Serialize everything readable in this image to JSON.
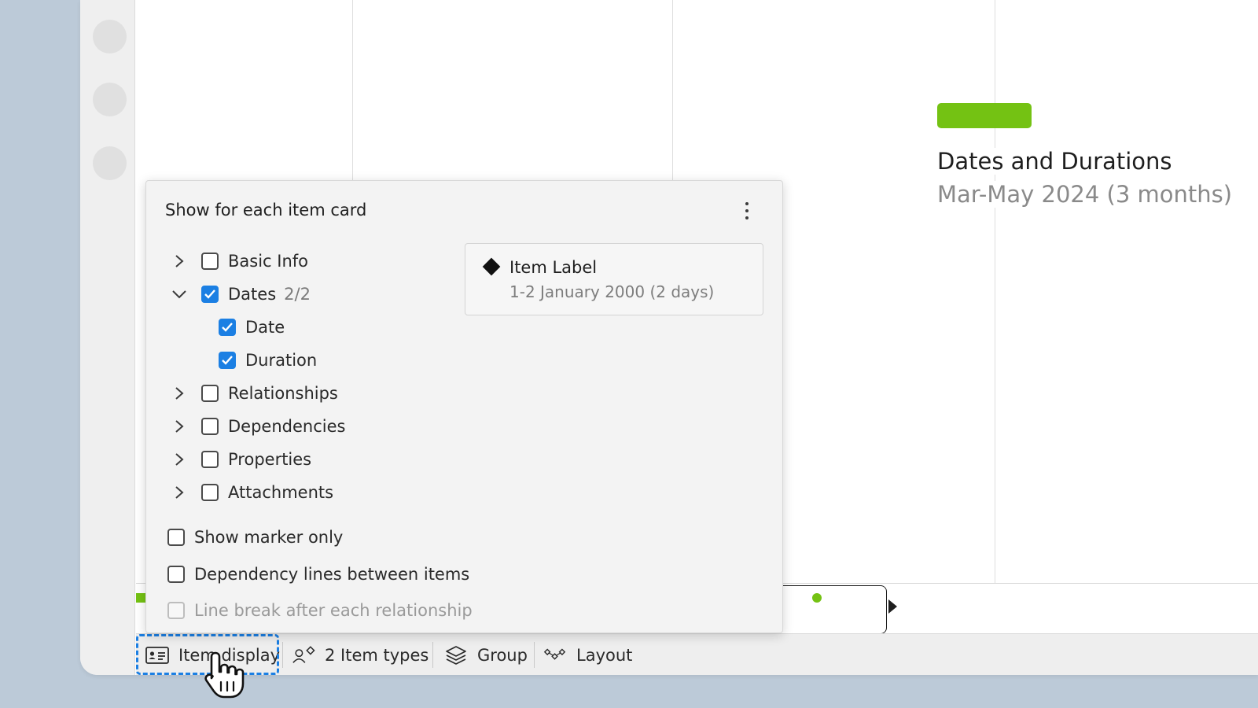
{
  "canvas": {
    "card": {
      "title": "Dates and Durations",
      "subtitle": "Mar-May 2024 (3 months)",
      "bar_color": "#74c213"
    }
  },
  "popover": {
    "title": "Show for each item card",
    "menu_icon": "kebab-menu-icon",
    "tree": [
      {
        "label": "Basic Info",
        "expanded": false,
        "checked": false
      },
      {
        "label": "Dates",
        "count": "2/2",
        "expanded": true,
        "checked": true,
        "children": [
          {
            "label": "Date",
            "checked": true
          },
          {
            "label": "Duration",
            "checked": true
          }
        ]
      },
      {
        "label": "Relationships",
        "expanded": false,
        "checked": false
      },
      {
        "label": "Dependencies",
        "expanded": false,
        "checked": false
      },
      {
        "label": "Properties",
        "expanded": false,
        "checked": false
      },
      {
        "label": "Attachments",
        "expanded": false,
        "checked": false
      }
    ],
    "options": [
      {
        "label": "Show marker only",
        "checked": false,
        "disabled": false
      },
      {
        "label": "Dependency lines between items",
        "checked": false,
        "disabled": false
      },
      {
        "label": "Line break after each relationship",
        "checked": false,
        "disabled": true
      }
    ],
    "preview": {
      "label": "Item Label",
      "detail": "1-2 January 2000 (2 days)"
    }
  },
  "toolbar": {
    "item_display": "Item display",
    "item_types": "2 Item types",
    "group": "Group",
    "layout": "Layout"
  },
  "colors": {
    "accent": "#1b7fe3",
    "green": "#74c213",
    "background": "#bccad8"
  }
}
